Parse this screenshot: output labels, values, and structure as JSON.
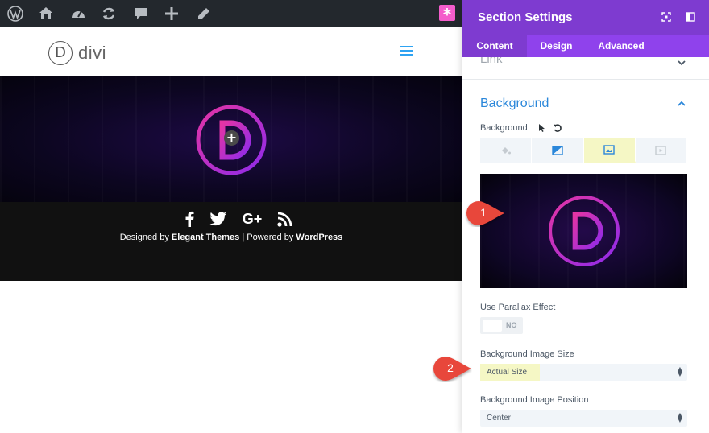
{
  "adminbar": {
    "icons": [
      "wordpress-icon",
      "sitemap-icon",
      "dashboard-icon",
      "updates-icon",
      "comments-icon",
      "new-icon",
      "edit-icon"
    ],
    "divi_icon": "divi-star-icon",
    "bg_color": "#23282d"
  },
  "site": {
    "logo_letter": "D",
    "logo_text": "divi",
    "menu_icon": "hamburger-icon",
    "hero_add_icon": "+",
    "accent": "#2ea3f2"
  },
  "footer": {
    "social_icons": [
      "facebook-icon",
      "twitter-icon",
      "google-plus-icon",
      "rss-icon"
    ],
    "google_plus_label": "G+",
    "credit_prefix": "Designed by",
    "credit_brand": "Elegant Themes",
    "credit_sep": "| Powered by",
    "credit_platform": "WordPress"
  },
  "panel": {
    "title": "Section Settings",
    "tabs": [
      {
        "label": "Content",
        "active": true
      },
      {
        "label": "Design",
        "active": false
      },
      {
        "label": "Advanced",
        "active": false
      }
    ],
    "collapsed_section": "Link",
    "section_title": "Background",
    "background_label": "Background",
    "bg_type_tabs": [
      "color-icon",
      "gradient-icon",
      "image-icon",
      "video-icon"
    ],
    "active_bg_type": "image-icon",
    "parallax_label": "Use Parallax Effect",
    "parallax_value": "NO",
    "image_size_label": "Background Image Size",
    "image_size_value": "Actual Size",
    "image_position_label": "Background Image Position",
    "image_position_value": "Center",
    "header_color": "#7e3bd0",
    "tabs_color": "#8f42ec"
  },
  "annotations": [
    {
      "number": "1"
    },
    {
      "number": "2"
    }
  ],
  "brand_gradient": [
    "#e434a4",
    "#8e2bea"
  ]
}
